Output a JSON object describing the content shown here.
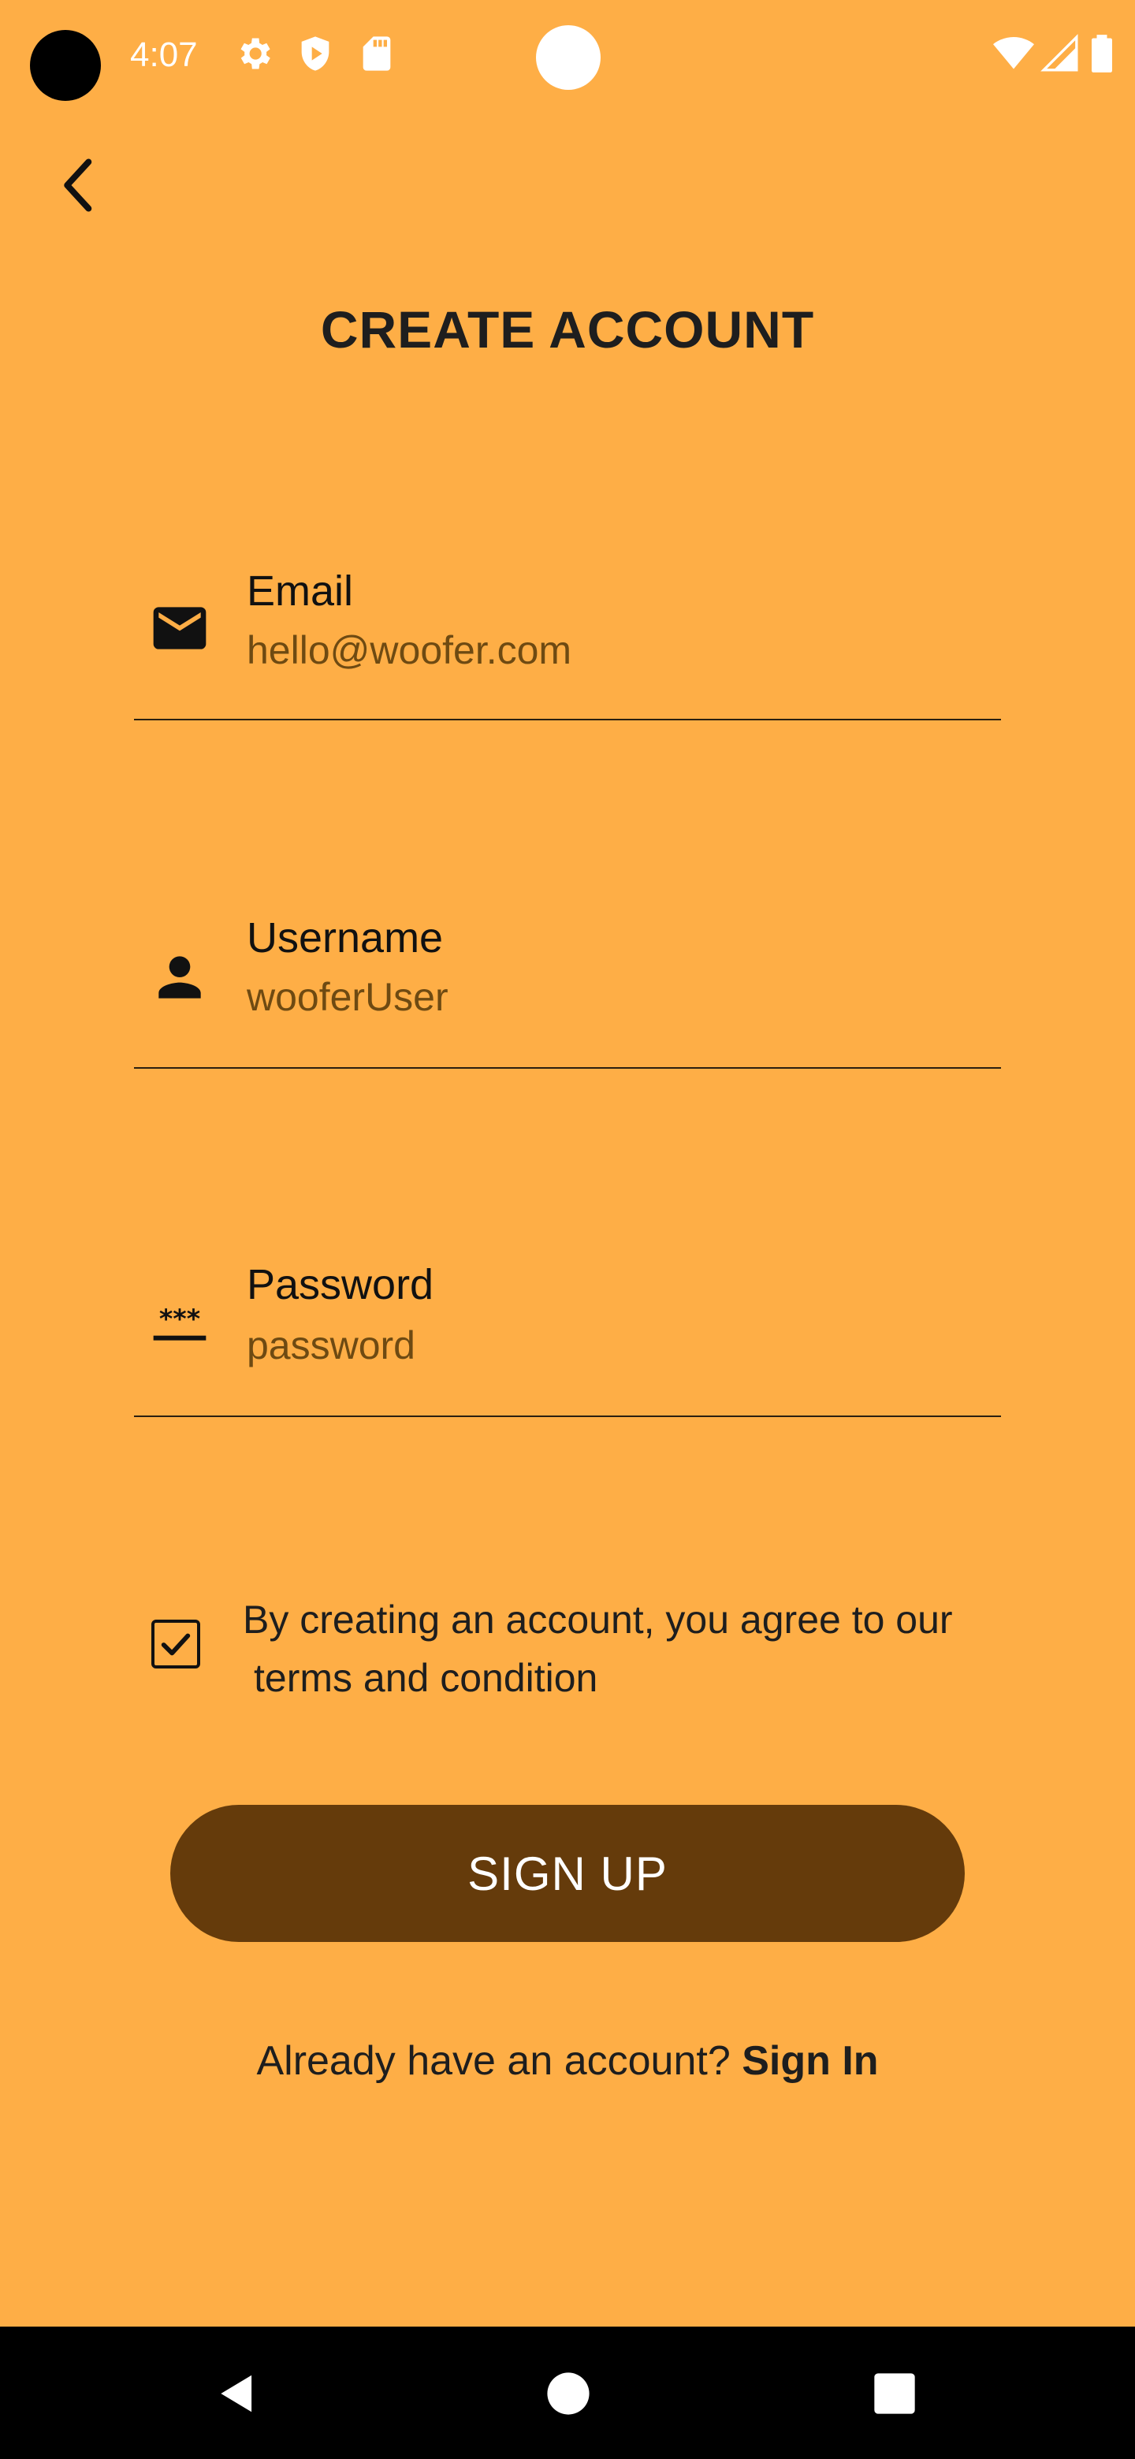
{
  "status_bar": {
    "time": "4:07",
    "icons": [
      "settings-icon",
      "shield-play-icon",
      "sd-card-icon",
      "wifi-icon",
      "signal-icon",
      "battery-icon"
    ]
  },
  "header": {
    "title": "CREATE ACCOUNT"
  },
  "form": {
    "email": {
      "label": "Email",
      "value": "hello@woofer.com",
      "icon": "email-icon"
    },
    "username": {
      "label": "Username",
      "value": "wooferUser",
      "icon": "person-icon"
    },
    "password": {
      "label": "Password",
      "placeholder": "password",
      "icon": "password-icon"
    },
    "terms": {
      "line1": "By creating an account, you agree to our",
      "line2": "terms and condition",
      "checked": true
    },
    "signup_label": "SIGN UP",
    "signin_prompt": "Already have an account?",
    "signin_link": "Sign In"
  },
  "colors": {
    "background": "#FEAE46",
    "button": "#653B0B",
    "input_text": "#6E4A12"
  }
}
